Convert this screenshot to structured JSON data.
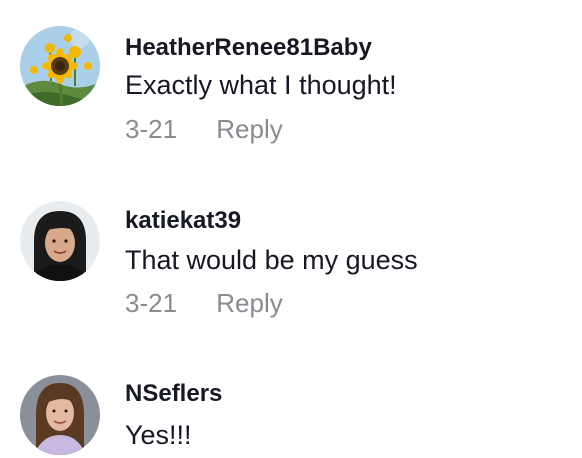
{
  "comments": [
    {
      "username": "HeatherRenee81Baby",
      "text": "Exactly what I thought!",
      "date": "3-21",
      "reply_label": "Reply",
      "avatar": "sunflower-avatar"
    },
    {
      "username": "katiekat39",
      "text": "That would be my guess",
      "date": "3-21",
      "reply_label": "Reply",
      "avatar": "woman-dark-hair-avatar"
    },
    {
      "username": "NSeflers",
      "text": "Yes!!!",
      "avatar": "woman-brown-hair-avatar"
    }
  ],
  "colors": {
    "username": "#161823",
    "text": "#161823",
    "meta": "#8a8b91"
  }
}
